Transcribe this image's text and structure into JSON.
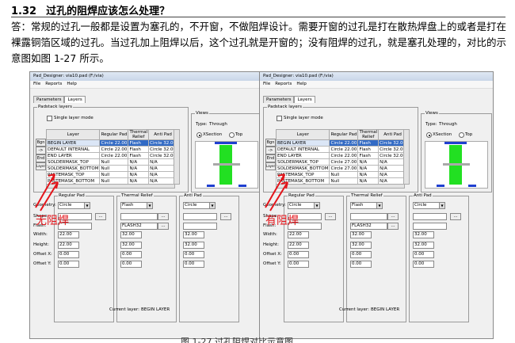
{
  "section": {
    "number": "1.32",
    "title": "过孔的阻焊应该怎么处理？"
  },
  "answer": "答：常规的过孔一般都是设置为塞孔的，不开窗，不做阻焊设计。需要开窗的过孔是打在散热焊盘上的或者是打在裸露铜箔区域的过孔。当过孔加上阻焊以后，这个过孔就是开窗的；没有阻焊的过孔，就是塞孔处理的，对比的示意图如图 1-27 所示。",
  "figure_caption": "图 1-27 过孔阻焊对比示意图",
  "colors": {
    "pad_blue": "#1f3fd0",
    "pad_gray": "#a9a9a9",
    "barrel_green": "#22e022",
    "annotation_red": "#e3151b",
    "selected_row": "#316ac5"
  },
  "screenshots": [
    {
      "annotation": "无阻焊",
      "window_title": "Pad_Designer: via10.pad (F:/via)",
      "menu": [
        "File",
        "Reports",
        "Help"
      ],
      "tabs": [
        "Parameters",
        "Layers"
      ],
      "padstack_group": "Padstack layers",
      "single_layer_mode": "Single layer mode",
      "side_buttons": [
        "Bgn",
        "->",
        "End",
        "Layer"
      ],
      "columns": [
        "Layer",
        "Regular Pad",
        "Thermal Relief",
        "Anti Pad"
      ],
      "rows": [
        {
          "layer": "BEGIN LAYER",
          "regular": "Circle 22.00",
          "thermal": "Flash",
          "anti": "Circle 32.00"
        },
        {
          "layer": "DEFAULT INTERNAL",
          "regular": "Circle 22.00",
          "thermal": "Flash",
          "anti": "Circle 32.00"
        },
        {
          "layer": "END LAYER",
          "regular": "Circle 22.00",
          "thermal": "Flash",
          "anti": "Circle 32.00"
        },
        {
          "layer": "SOLDERMASK_TOP",
          "regular": "Null",
          "thermal": "N/A",
          "anti": "N/A"
        },
        {
          "layer": "SOLDERMASK_BOTTOM",
          "regular": "Null",
          "thermal": "N/A",
          "anti": "N/A"
        },
        {
          "layer": "PASTEMASK_TOP",
          "regular": "Null",
          "thermal": "N/A",
          "anti": "N/A"
        },
        {
          "layer": "PASTEMASK_BOTTOM",
          "regular": "Null",
          "thermal": "N/A",
          "anti": "N/A"
        }
      ],
      "views": {
        "label": "Views",
        "type_label": "Type:",
        "type_value": "Through",
        "xsection": "XSection",
        "top": "Top"
      },
      "pad_groups": [
        "Regular Pad",
        "Thermal Relief",
        "Anti Pad"
      ],
      "field_labels": [
        "Geometry:",
        "Shape:",
        "Flash:",
        "Width:",
        "Height:",
        "Offset X:",
        "Offset Y:"
      ],
      "geometry": [
        "Circle",
        "Flash",
        "Circle"
      ],
      "flash_value": "FLASH32",
      "width": [
        "22.00",
        "32.00",
        "32.00"
      ],
      "height": [
        "22.00",
        "32.00",
        "32.00"
      ],
      "offset_x": [
        "0.00",
        "0.00",
        "0.00"
      ],
      "offset_y": [
        "0.00",
        "0.00",
        "0.00"
      ],
      "current_layer_label": "Current layer:",
      "current_layer": "BEGIN LAYER"
    },
    {
      "annotation": "有阻焊",
      "window_title": "Pad_Designer: via10.pad (F:/via)",
      "menu": [
        "File",
        "Reports",
        "Help"
      ],
      "tabs": [
        "Parameters",
        "Layers"
      ],
      "padstack_group": "Padstack layers",
      "single_layer_mode": "Single layer mode",
      "side_buttons": [
        "Bgn",
        "->",
        "End",
        "Layer"
      ],
      "columns": [
        "Layer",
        "Regular Pad",
        "Thermal Relief",
        "Anti Pad"
      ],
      "rows": [
        {
          "layer": "BEGIN LAYER",
          "regular": "Circle 22.00",
          "thermal": "Flash",
          "anti": "Circle 32.00"
        },
        {
          "layer": "DEFAULT INTERNAL",
          "regular": "Circle 22.00",
          "thermal": "Flash",
          "anti": "Circle 32.00"
        },
        {
          "layer": "END LAYER",
          "regular": "Circle 22.00",
          "thermal": "Flash",
          "anti": "Circle 32.00"
        },
        {
          "layer": "SOLDERMASK_TOP",
          "regular": "Circle 27.00",
          "thermal": "N/A",
          "anti": "N/A"
        },
        {
          "layer": "SOLDERMASK_BOTTOM",
          "regular": "Circle 27.00",
          "thermal": "N/A",
          "anti": "N/A"
        },
        {
          "layer": "PASTEMASK_TOP",
          "regular": "Null",
          "thermal": "N/A",
          "anti": "N/A"
        },
        {
          "layer": "PASTEMASK_BOTTOM",
          "regular": "Null",
          "thermal": "N/A",
          "anti": "N/A"
        }
      ],
      "views": {
        "label": "Views",
        "type_label": "Type:",
        "type_value": "Through",
        "xsection": "XSection",
        "top": "Top"
      },
      "pad_groups": [
        "Regular Pad",
        "Thermal Relief",
        "Anti Pad"
      ],
      "field_labels": [
        "Geometry:",
        "Shape:",
        "Flash:",
        "Width:",
        "Height:",
        "Offset X:",
        "Offset Y:"
      ],
      "geometry": [
        "Circle",
        "Flash",
        "Circle"
      ],
      "flash_value": "FLASH32",
      "width": [
        "22.00",
        "32.00",
        "32.00"
      ],
      "height": [
        "22.00",
        "32.00",
        "32.00"
      ],
      "offset_x": [
        "0.00",
        "0.00",
        "0.00"
      ],
      "offset_y": [
        "0.00",
        "0.00",
        "0.00"
      ],
      "current_layer_label": "Current layer:",
      "current_layer": "BEGIN LAYER"
    }
  ]
}
